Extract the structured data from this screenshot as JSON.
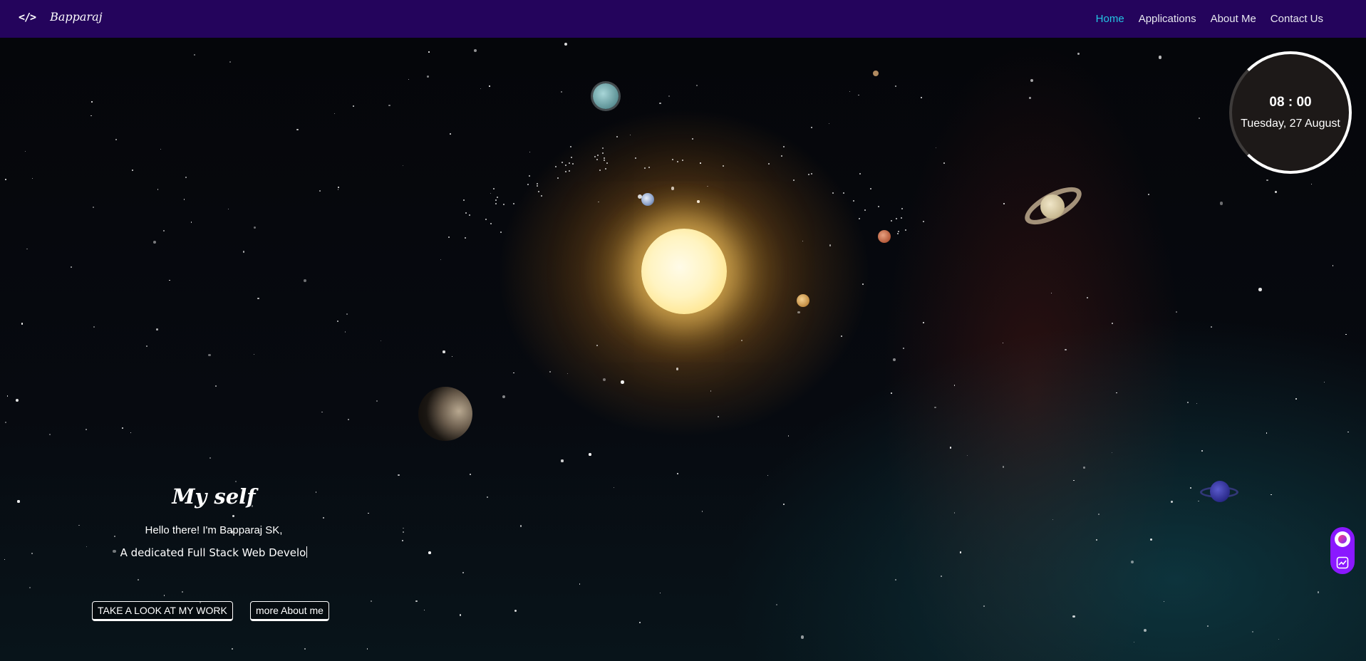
{
  "nav": {
    "brand_icon": "</>",
    "brand_name": "Bapparaj",
    "links": [
      {
        "label": "Home",
        "active": true
      },
      {
        "label": "Applications",
        "active": false
      },
      {
        "label": "About Me",
        "active": false
      },
      {
        "label": "Contact Us",
        "active": false
      }
    ]
  },
  "clock": {
    "time": "08 : 00",
    "date": "Tuesday, 27 August"
  },
  "intro": {
    "title": "My self",
    "line1": "Hello there! I'm Bapparaj SK,",
    "line2": "A dedicated Full Stack Web Develo"
  },
  "buttons": {
    "work": "TAKE A LOOK AT MY WORK",
    "about": "more About me"
  },
  "colors": {
    "navbar": "#24045c",
    "active_link": "#23c4e3",
    "widget": "#8a18ff"
  },
  "icons": {
    "brand": "code-icon",
    "widget_top": "chat-bubble-icon",
    "widget_bottom": "chart-icon"
  }
}
